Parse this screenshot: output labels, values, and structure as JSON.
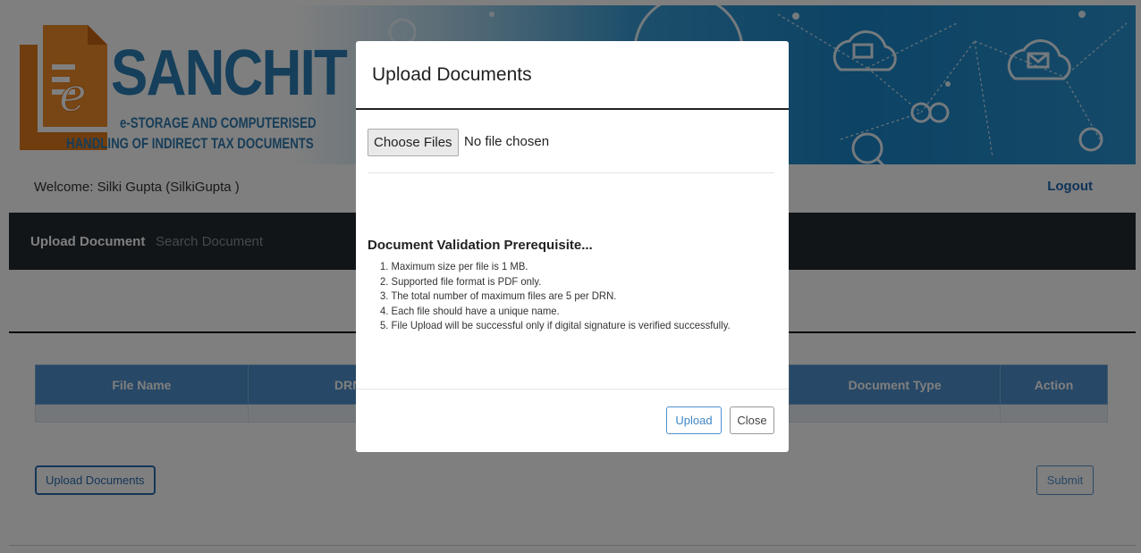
{
  "header": {
    "logo_title": "SANCHIT",
    "logo_subtitle_line1": "e-STORAGE AND COMPUTERISED",
    "logo_subtitle_line2": "HANDLING OF INDIRECT TAX DOCUMENTS",
    "welcome_text": "Welcome: Silki Gupta (SilkiGupta )",
    "logout_label": "Logout"
  },
  "nav": {
    "items": [
      {
        "label": "Upload Document",
        "active": true
      },
      {
        "label": "Search Document",
        "active": false
      }
    ]
  },
  "table": {
    "columns": [
      "File Name",
      "DRN",
      "",
      "",
      "Document Type",
      "Action"
    ]
  },
  "buttons": {
    "upload_documents": "Upload Documents",
    "submit": "Submit"
  },
  "modal": {
    "title": "Upload Documents",
    "choose_files_label": "Choose Files",
    "file_status": "No file chosen",
    "validation_title": "Document Validation Prerequisite...",
    "validation_items": [
      "1. Maximum size per file is 1 MB.",
      "2. Supported file format is PDF only.",
      "3. The total number of maximum files are 5 per DRN.",
      "4. Each file should have a unique name.",
      "5. File Upload will be successful only if digital signature is verified successfully."
    ],
    "upload_label": "Upload",
    "close_label": "Close"
  },
  "colors": {
    "brand_blue": "#2a7fb6",
    "logo_orange": "#e07a1f",
    "nav_bg": "#222a30",
    "table_header": "#4f90cc"
  }
}
